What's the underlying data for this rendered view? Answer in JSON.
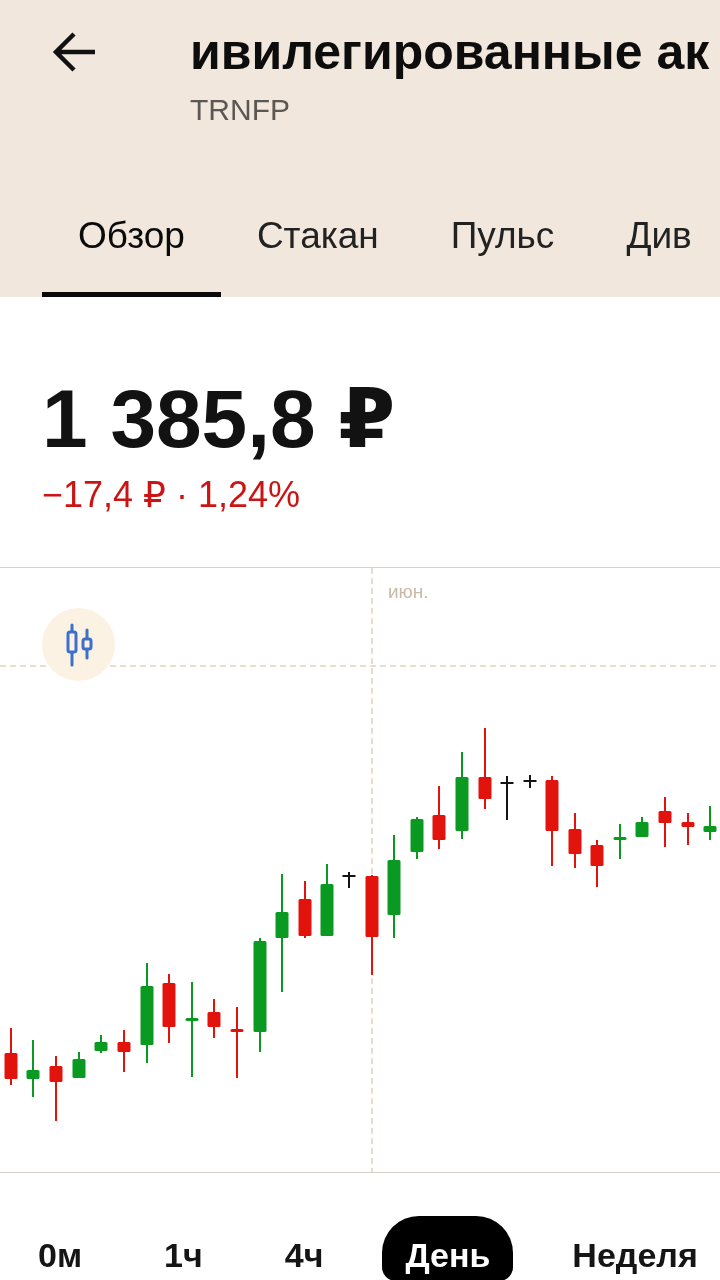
{
  "header": {
    "title": "ивилегированные ак",
    "ticker": "TRNFP",
    "tabs": [
      {
        "label": "Обзор",
        "selected": true
      },
      {
        "label": "Стакан",
        "selected": false
      },
      {
        "label": "Пульс",
        "selected": false
      },
      {
        "label": "Див",
        "selected": false
      }
    ]
  },
  "quote": {
    "price": "1 385,8 ₽",
    "change": "−17,4 ₽ · 1,24%",
    "falling": true
  },
  "chart": {
    "month_label": "июн."
  },
  "periods": [
    {
      "label": "0м",
      "selected": false
    },
    {
      "label": "1ч",
      "selected": false
    },
    {
      "label": "4ч",
      "selected": false
    },
    {
      "label": "День",
      "selected": true
    },
    {
      "label": "Неделя",
      "selected": false
    }
  ]
}
